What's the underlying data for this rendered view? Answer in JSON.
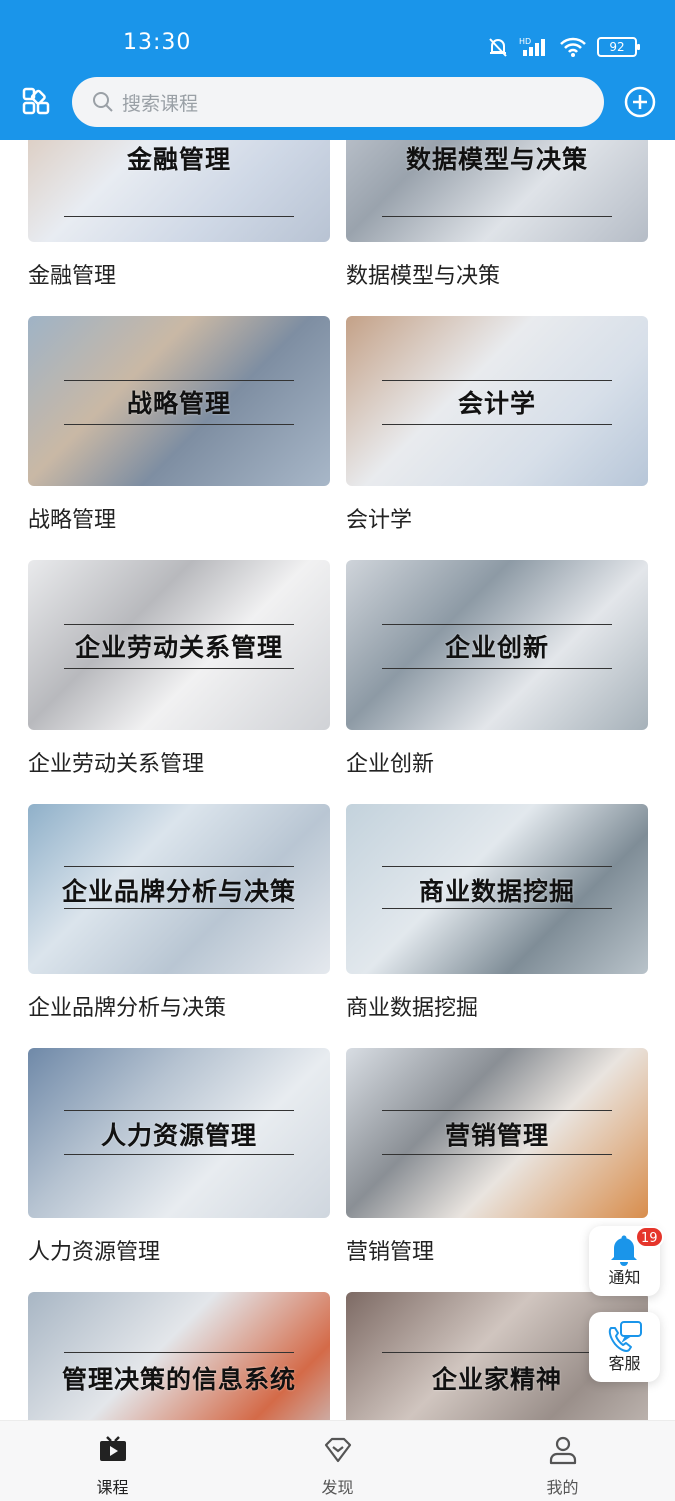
{
  "status_bar": {
    "time": "13:30",
    "battery": "92"
  },
  "header": {
    "search_placeholder": "搜索课程"
  },
  "courses": [
    {
      "label": "金融管理",
      "banner": "金融管理"
    },
    {
      "label": "数据模型与决策",
      "banner": "数据模型与决策"
    },
    {
      "label": "战略管理",
      "banner": "战略管理"
    },
    {
      "label": "会计学",
      "banner": "会计学"
    },
    {
      "label": "企业劳动关系管理",
      "banner": "企业劳动关系管理"
    },
    {
      "label": "企业创新",
      "banner": "企业创新"
    },
    {
      "label": "企业品牌分析与决策",
      "banner": "企业品牌分析与决策"
    },
    {
      "label": "商业数据挖掘",
      "banner": "商业数据挖掘"
    },
    {
      "label": "人力资源管理",
      "banner": "人力资源管理"
    },
    {
      "label": "营销管理",
      "banner": "营销管理"
    },
    {
      "label": "",
      "banner": "管理决策的信息系统"
    },
    {
      "label": "",
      "banner": "企业家精神"
    }
  ],
  "floating": {
    "notify_label": "通知",
    "notify_count": "19",
    "service_label": "客服"
  },
  "bottom_nav": {
    "items": [
      {
        "label": "课程",
        "icon": "play-board-icon",
        "active": true
      },
      {
        "label": "发现",
        "icon": "diamond-icon",
        "active": false
      },
      {
        "label": "我的",
        "icon": "person-icon",
        "active": false
      }
    ]
  },
  "colors": {
    "brand": "#1a95ea",
    "badge": "#e5352b"
  }
}
